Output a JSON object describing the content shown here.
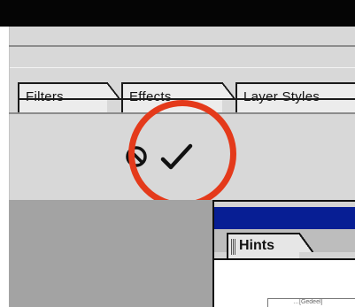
{
  "toolbar": {
    "tabs": [
      {
        "label": "Filters"
      },
      {
        "label": "Effects"
      },
      {
        "label": "Layer Styles"
      }
    ],
    "actions": {
      "cancel_icon": "cancel-icon",
      "commit_icon": "checkmark-icon"
    }
  },
  "palette": {
    "tab_label": "Hints",
    "snippet_text": "…[Gedeel]"
  },
  "colors": {
    "highlight": "#e43a1b",
    "titlebar": "#071e94"
  }
}
